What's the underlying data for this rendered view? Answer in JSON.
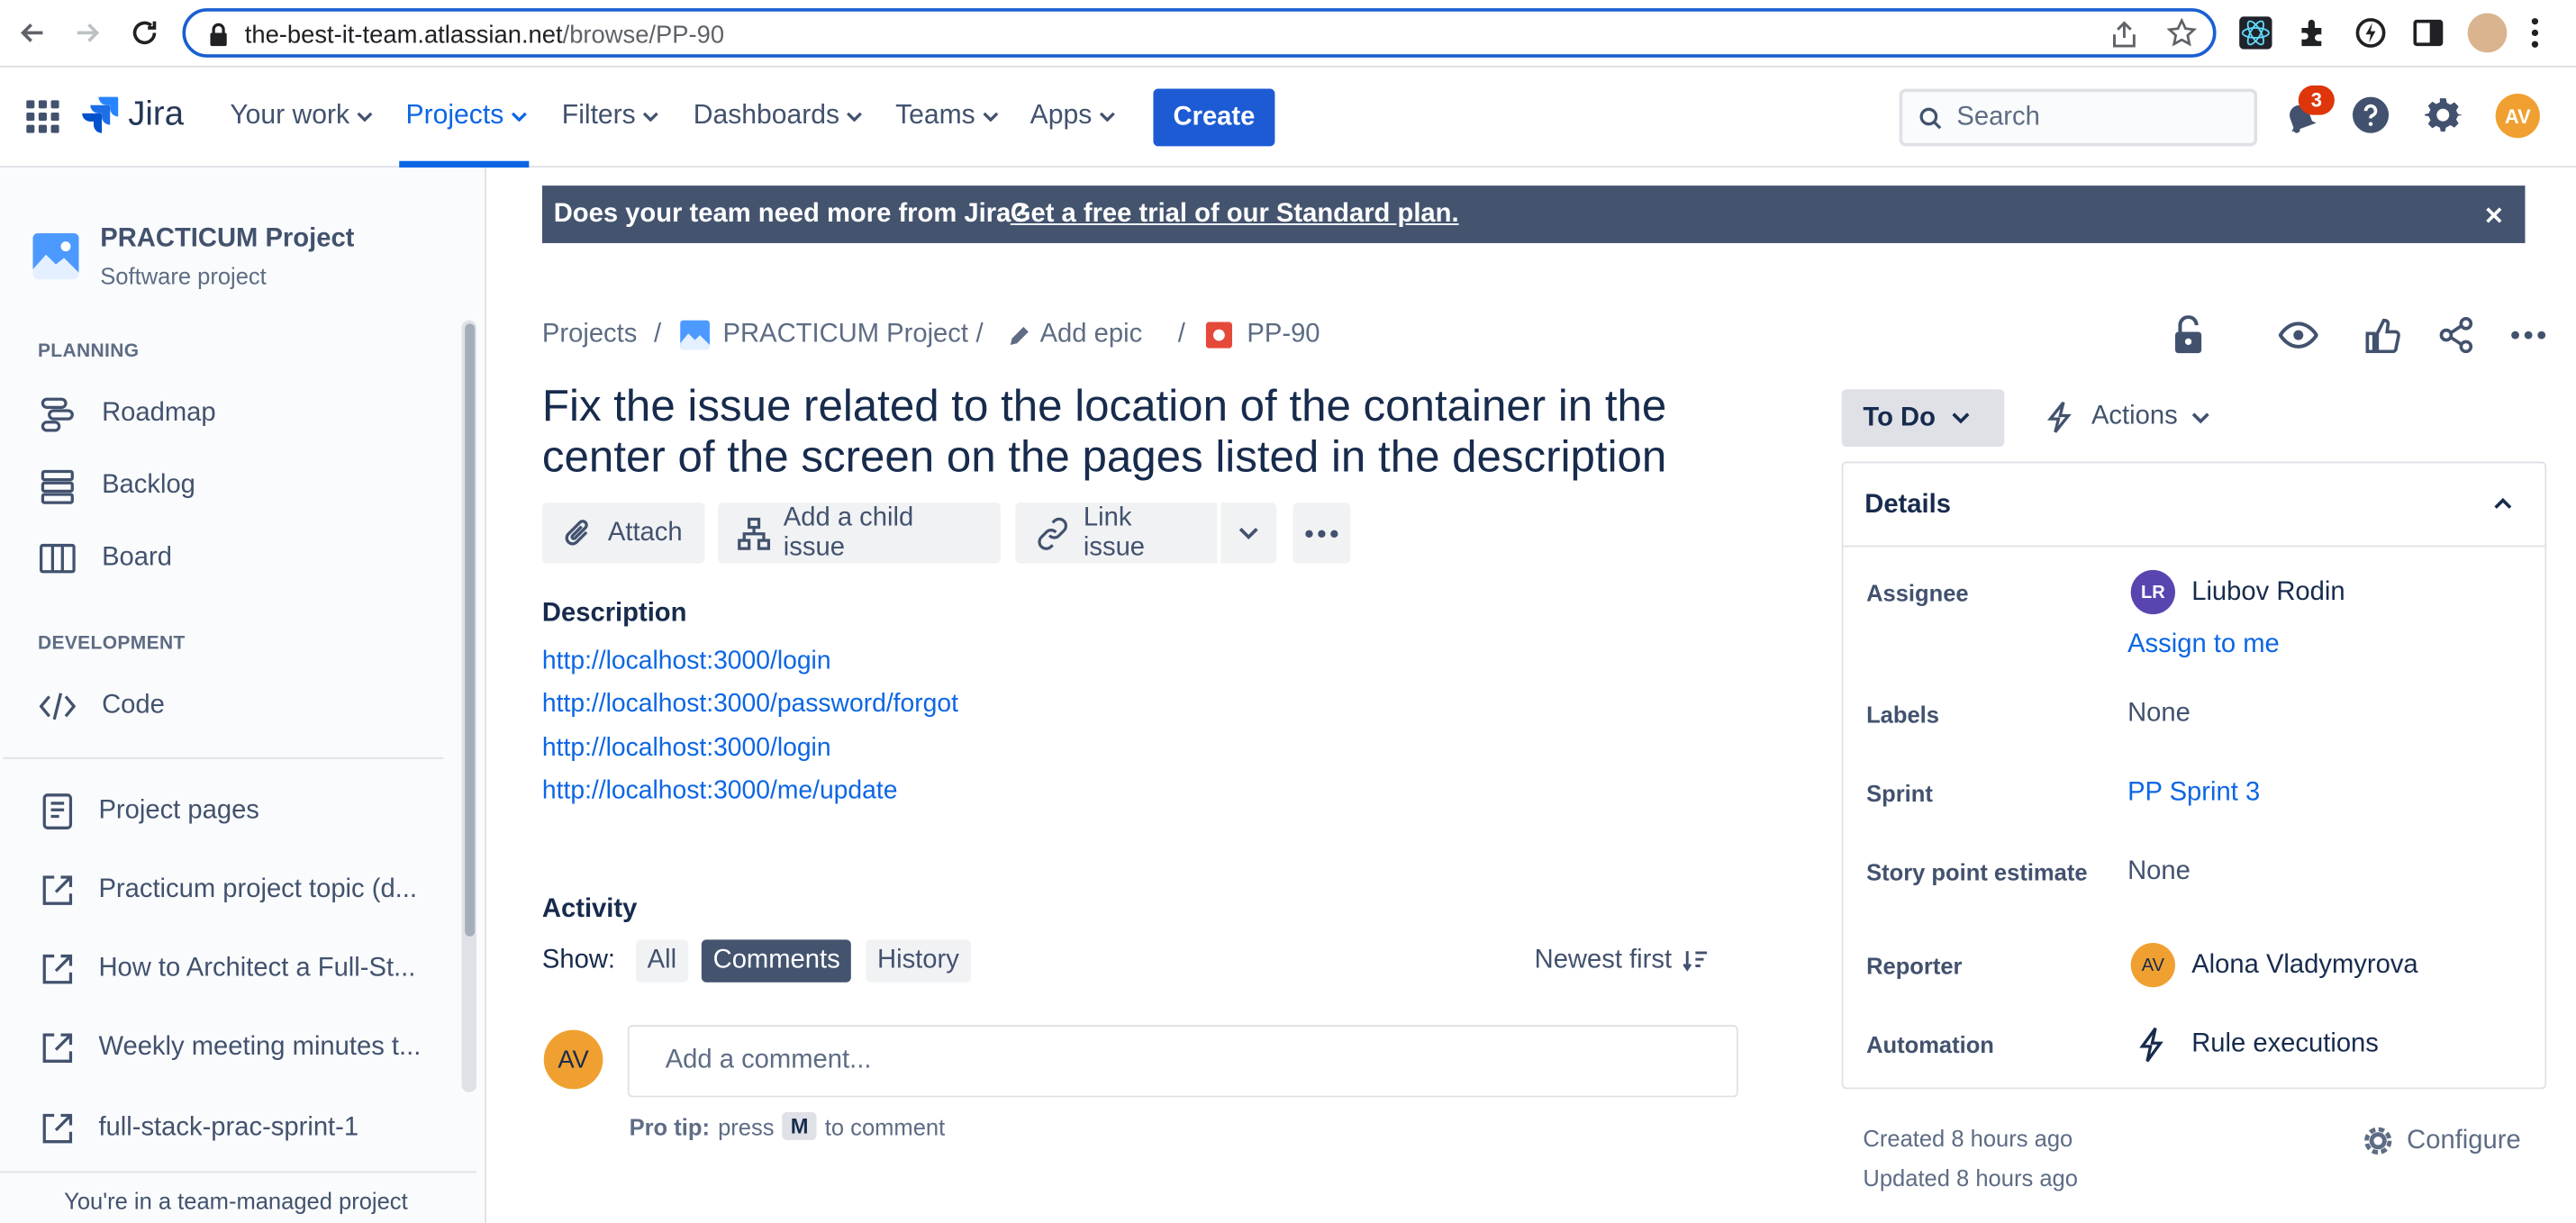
{
  "browser": {
    "url_domain": "the-best-it-team.atlassian.net",
    "url_path": "/browse/PP-90"
  },
  "nav": {
    "logo_text": "Jira",
    "items": [
      "Your work",
      "Projects",
      "Filters",
      "Dashboards",
      "Teams",
      "Apps"
    ],
    "create_label": "Create",
    "search_placeholder": "Search",
    "notification_count": "3",
    "user_initials": "AV"
  },
  "sidebar": {
    "project_name": "PRACTICUM Project",
    "project_type": "Software project",
    "planning_heading": "PLANNING",
    "planning_items": [
      "Roadmap",
      "Backlog",
      "Board"
    ],
    "development_heading": "DEVELOPMENT",
    "development_items": [
      "Code"
    ],
    "links": [
      "Project pages",
      "Practicum project topic (d...",
      "How to Architect a Full-St...",
      "Weekly meeting minutes t...",
      "full-stack-prac-sprint-1"
    ],
    "footer": "You're in a team-managed project"
  },
  "banner": {
    "text": "Does your team need more from Jira?",
    "link": "Get a free trial of our Standard plan."
  },
  "breadcrumb": {
    "projects": "Projects",
    "project": "PRACTICUM Project",
    "epic": "Add epic",
    "issue": "PP-90"
  },
  "issue": {
    "title": "Fix the issue related to the location of the container in the center of the screen on the pages listed in the description",
    "buttons": {
      "attach": "Attach",
      "child": "Add a child issue",
      "link": "Link issue"
    },
    "description_heading": "Description",
    "description_links": [
      "http://localhost:3000/login",
      "http://localhost:3000/password/forgot",
      "http://localhost:3000/login",
      "http://localhost:3000/me/update"
    ]
  },
  "activity": {
    "heading": "Activity",
    "show_label": "Show:",
    "tabs": [
      "All",
      "Comments",
      "History"
    ],
    "sort_label": "Newest first",
    "comment_placeholder": "Add a comment...",
    "commenter_initials": "AV",
    "pro_tip_label": "Pro tip:",
    "pro_tip_press": "press",
    "pro_tip_key": "M",
    "pro_tip_rest": "to comment"
  },
  "details": {
    "status": "To Do",
    "actions": "Actions",
    "heading": "Details",
    "assignee_label": "Assignee",
    "assignee_initials": "LR",
    "assignee_name": "Liubov Rodin",
    "assign_to_me": "Assign to me",
    "labels_label": "Labels",
    "labels_value": "None",
    "sprint_label": "Sprint",
    "sprint_value": "PP Sprint 3",
    "story_label": "Story point estimate",
    "story_value": "None",
    "reporter_label": "Reporter",
    "reporter_initials": "AV",
    "reporter_name": "Alona Vladymyrova",
    "automation_label": "Automation",
    "automation_value": "Rule executions",
    "created": "Created 8 hours ago",
    "updated": "Updated 8 hours ago",
    "configure": "Configure"
  },
  "colors": {
    "accent": "#0C66E4",
    "create_button": "#1D5BD5",
    "banner_bg": "#44546F",
    "avatar_orange": "#F0A030",
    "avatar_purple": "#5A44B0",
    "notification_red": "#DE350B"
  }
}
